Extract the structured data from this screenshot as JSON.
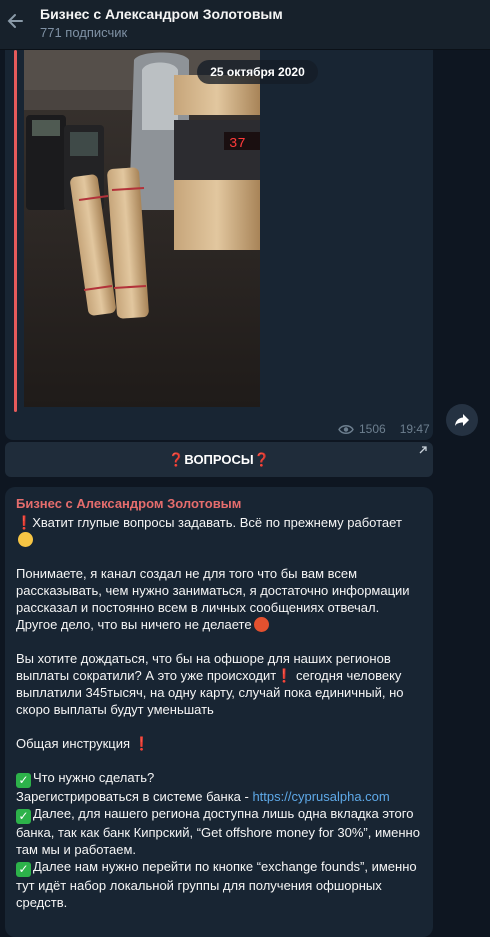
{
  "header": {
    "title": "Бизнес с Александром Золотовым",
    "subtitle": "771 подписчик"
  },
  "media_post": {
    "date_chip": "25 октября 2020",
    "views": "1506",
    "time": "19:47"
  },
  "inline_button": {
    "label": "ВОПРОСЫ",
    "prefix": "❓",
    "suffix": "❓"
  },
  "text_post": {
    "author": "Бизнес с Александром Золотовым",
    "line1": "Хватит глупые вопросы задавать. Всё по прежнему работает",
    "para2": "Понимаете, я канал создал не для того что бы вам всем рассказывать, чем нужно заниматься, я достаточно информации рассказал и постоянно всем в личных сообщениях отвечал. Другое дело, что вы ничего не делаете",
    "para3a": "Вы хотите дождаться, что бы на офшоре для наших регионов выплаты сократили? А это уже происходит",
    "para3b": " сегодня человеку выплатили 345тысяч, на одну карту, случай пока единичный, но скоро выплаты будут уменьшать",
    "para4": "Общая инструкция ",
    "step1_title": "Что нужно сделать?",
    "step1_text": "Зарегистрироваться в системе банка - ",
    "step1_link": "https://cyprusalpha.com",
    "step2": "Далее, для нашего региона доступна лишь одна вкладка этого банка, так как банк Кипрский, “Get offshore money for 30%”, именно там мы и работаем.",
    "step3": "Далее нам нужно перейти по кнопке “exchange founds”, именно тут идёт набор локальной группы для получения офшорных средств."
  },
  "colors": {
    "background": "#0e1621",
    "header": "#17212b",
    "bubble": "#182533",
    "author": "#e56d6d",
    "link": "#5ea9e8",
    "check": "#2db24a"
  }
}
